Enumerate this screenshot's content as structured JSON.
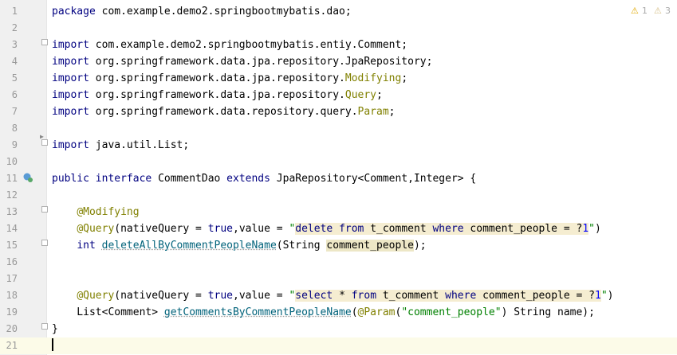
{
  "editor": {
    "warnings": {
      "warn_count": "1",
      "weak_count": "3"
    },
    "lines": [
      {
        "num": "1",
        "segments": [
          {
            "t": "package",
            "c": "kw"
          },
          {
            "t": " com.example.demo2.springbootmybatis.dao;"
          }
        ]
      },
      {
        "num": "2",
        "segments": []
      },
      {
        "num": "3",
        "segments": [
          {
            "t": "import",
            "c": "kw"
          },
          {
            "t": " com.example.demo2.springbootmybatis.entiy.Comment;"
          }
        ]
      },
      {
        "num": "4",
        "segments": [
          {
            "t": "import",
            "c": "kw"
          },
          {
            "t": " org.springframework.data.jpa.repository.JpaRepository;"
          }
        ]
      },
      {
        "num": "5",
        "segments": [
          {
            "t": "import",
            "c": "kw"
          },
          {
            "t": " org.springframework.data.jpa.repository."
          },
          {
            "t": "Modifying",
            "c": "ann"
          },
          {
            "t": ";"
          }
        ]
      },
      {
        "num": "6",
        "segments": [
          {
            "t": "import",
            "c": "kw"
          },
          {
            "t": " org.springframework.data.jpa.repository."
          },
          {
            "t": "Query",
            "c": "ann"
          },
          {
            "t": ";"
          }
        ]
      },
      {
        "num": "7",
        "segments": [
          {
            "t": "import",
            "c": "kw"
          },
          {
            "t": " org.springframework.data.repository.query."
          },
          {
            "t": "Param",
            "c": "ann"
          },
          {
            "t": ";"
          }
        ]
      },
      {
        "num": "8",
        "segments": []
      },
      {
        "num": "9",
        "segments": [
          {
            "t": "import",
            "c": "kw"
          },
          {
            "t": " java.util.List;"
          }
        ]
      },
      {
        "num": "10",
        "segments": []
      },
      {
        "num": "11",
        "segments": [
          {
            "t": "public",
            "c": "kw"
          },
          {
            "t": " "
          },
          {
            "t": "interface",
            "c": "kw"
          },
          {
            "t": " CommentDao "
          },
          {
            "t": "extends",
            "c": "kw"
          },
          {
            "t": " JpaRepository<Comment,Integer> {"
          }
        ]
      },
      {
        "num": "12",
        "segments": []
      },
      {
        "num": "13",
        "segments": [
          {
            "t": "    "
          },
          {
            "t": "@Modifying",
            "c": "ann"
          }
        ]
      },
      {
        "num": "14",
        "segments": [
          {
            "t": "    "
          },
          {
            "t": "@Query",
            "c": "ann"
          },
          {
            "t": "(nativeQuery = "
          },
          {
            "t": "true",
            "c": "kw"
          },
          {
            "t": ",value = "
          },
          {
            "t": "\"",
            "c": "str"
          },
          {
            "t": "delete from",
            "c": "sqlkw hlbg"
          },
          {
            "t": " t_comment ",
            "c": "hlbg"
          },
          {
            "t": "where",
            "c": "sqlkw hlbg"
          },
          {
            "t": " comment_people = ?",
            "c": "hlbg"
          },
          {
            "t": "1",
            "c": "num hlbg"
          },
          {
            "t": "\"",
            "c": "str"
          },
          {
            "t": ")"
          }
        ]
      },
      {
        "num": "15",
        "segments": [
          {
            "t": "    "
          },
          {
            "t": "int",
            "c": "kw"
          },
          {
            "t": " "
          },
          {
            "t": "deleteAllByCommentPeopleName",
            "c": "fn uline"
          },
          {
            "t": "(String "
          },
          {
            "t": "comment_people",
            "c": "varhl"
          },
          {
            "t": ");"
          }
        ]
      },
      {
        "num": "16",
        "segments": []
      },
      {
        "num": "17",
        "segments": []
      },
      {
        "num": "18",
        "segments": [
          {
            "t": "    "
          },
          {
            "t": "@Query",
            "c": "ann"
          },
          {
            "t": "(nativeQuery = "
          },
          {
            "t": "true",
            "c": "kw"
          },
          {
            "t": ",value = "
          },
          {
            "t": "\"",
            "c": "str"
          },
          {
            "t": "select",
            "c": "sqlkw hlbg"
          },
          {
            "t": " * ",
            "c": "hlbg"
          },
          {
            "t": "from",
            "c": "sqlkw hlbg"
          },
          {
            "t": " t_comment ",
            "c": "hlbg"
          },
          {
            "t": "where",
            "c": "sqlkw hlbg"
          },
          {
            "t": " comment_people = ?",
            "c": "hlbg"
          },
          {
            "t": "1",
            "c": "num hlbg"
          },
          {
            "t": "\"",
            "c": "str"
          },
          {
            "t": ")"
          }
        ]
      },
      {
        "num": "19",
        "segments": [
          {
            "t": "    List<Comment> "
          },
          {
            "t": "getCommentsByCommentPeopleName",
            "c": "fn uline"
          },
          {
            "t": "("
          },
          {
            "t": "@Param",
            "c": "ann"
          },
          {
            "t": "("
          },
          {
            "t": "\"comment_people\"",
            "c": "str"
          },
          {
            "t": ") String name);"
          }
        ]
      },
      {
        "num": "20",
        "segments": [
          {
            "t": "}"
          }
        ]
      },
      {
        "num": "21",
        "segments": []
      }
    ]
  }
}
